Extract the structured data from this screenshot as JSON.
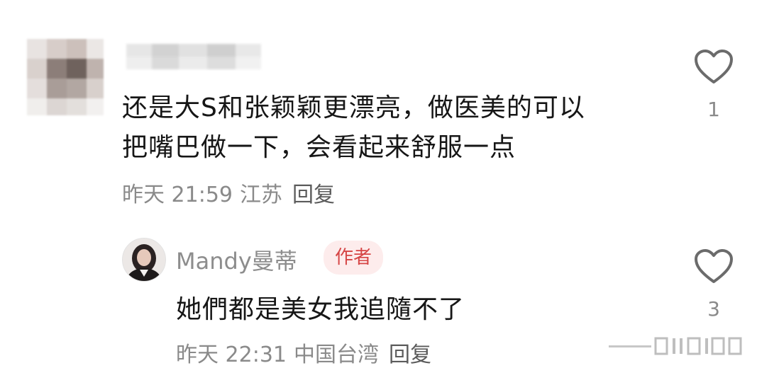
{
  "comment": {
    "text_line1": "还是大S和张颖颖更漂亮，做医美的可以",
    "text_line2": "把嘴巴做一下，会看起来舒服一点",
    "time": "昨天 21:59",
    "location": "江苏",
    "reply_label": "回复",
    "like_count": "1"
  },
  "reply": {
    "username": "Mandy曼蒂",
    "badge": "作者",
    "text": "她們都是美女我追隨不了",
    "time": "昨天 22:31",
    "location": "中国台湾",
    "reply_label": "回复",
    "like_count": "3"
  },
  "icons": {
    "like": "heart-outline-icon"
  },
  "colors": {
    "badge_bg": "#fdecec",
    "badge_text": "#d64545",
    "meta_text": "#8a8a8a"
  }
}
